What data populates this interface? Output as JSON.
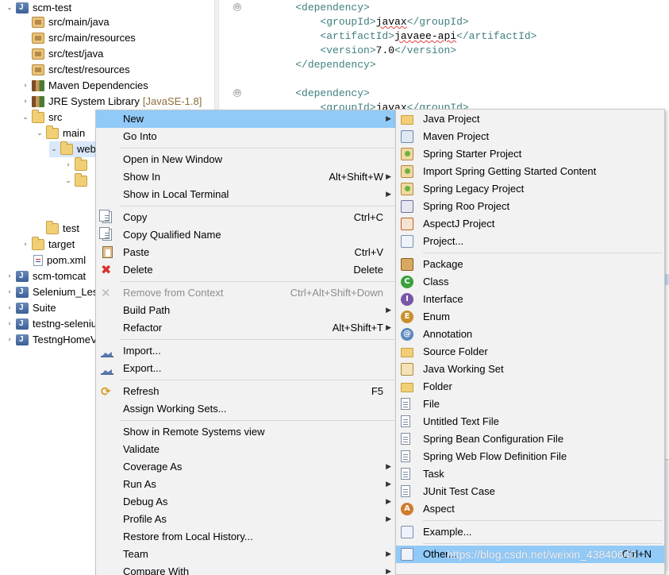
{
  "tree": {
    "items": [
      {
        "label": "scm-test",
        "twisty": "⌄"
      },
      {
        "label": "src/main/java"
      },
      {
        "label": "src/main/resources"
      },
      {
        "label": "src/test/java"
      },
      {
        "label": "src/test/resources"
      },
      {
        "label": "Maven Dependencies",
        "twisty": "›"
      },
      {
        "label": "JRE System Library",
        "decoration": "[JavaSE-1.8]",
        "twisty": "›"
      },
      {
        "label": "src",
        "twisty": "⌄"
      },
      {
        "label": "main",
        "twisty": "⌄"
      },
      {
        "label": "web",
        "twisty": "⌄"
      },
      {
        "label": "",
        "twisty": "›"
      },
      {
        "label": "",
        "twisty": "⌄"
      },
      {
        "label": "test"
      },
      {
        "label": "target",
        "twisty": "›"
      },
      {
        "label": "pom.xml"
      },
      {
        "label": "scm-tomcat",
        "twisty": "›"
      },
      {
        "label": "Selenium_Les",
        "twisty": "›"
      },
      {
        "label": "Suite",
        "twisty": "›"
      },
      {
        "label": "testng-seleniu",
        "twisty": "›"
      },
      {
        "label": "TestngHomeV",
        "twisty": "›"
      }
    ]
  },
  "editor": {
    "lines": [
      {
        "indent": "    ",
        "open": "<dependency>"
      },
      {
        "indent": "        ",
        "open": "<groupId>",
        "text": "javax",
        "close": "</groupId>"
      },
      {
        "indent": "        ",
        "open": "<artifactId>",
        "text": "javaee-api",
        "close": "</artifactId>"
      },
      {
        "indent": "        ",
        "open": "<version>",
        "text": "7.0",
        "close": "</version>"
      },
      {
        "indent": "    ",
        "open": "</dependency>"
      },
      {
        "indent": "    ",
        "open": "<dependency>"
      },
      {
        "indent": "        ",
        "open": "<groupId>",
        "text": "javax",
        "close": "</groupId>"
      }
    ],
    "fold_marker": "⊖"
  },
  "context_menu": {
    "items": [
      {
        "label": "New",
        "submenu": true,
        "highlighted": true
      },
      {
        "label": "Go Into"
      },
      {
        "label": "Open in New Window"
      },
      {
        "label": "Show In",
        "shortcut": "Alt+Shift+W",
        "submenu": true
      },
      {
        "label": "Show in Local Terminal",
        "submenu": true
      },
      {
        "label": "Copy",
        "shortcut": "Ctrl+C",
        "icon": "copy-icon"
      },
      {
        "label": "Copy Qualified Name",
        "icon": "copy-qualified-name-icon"
      },
      {
        "label": "Paste",
        "shortcut": "Ctrl+V",
        "icon": "paste-icon"
      },
      {
        "label": "Delete",
        "shortcut": "Delete",
        "icon": "delete-icon"
      },
      {
        "label": "Remove from Context",
        "shortcut": "Ctrl+Alt+Shift+Down",
        "disabled": true,
        "icon": "remove-icon"
      },
      {
        "label": "Build Path",
        "submenu": true
      },
      {
        "label": "Refactor",
        "shortcut": "Alt+Shift+T",
        "submenu": true
      },
      {
        "label": "Import...",
        "icon": "import-icon"
      },
      {
        "label": "Export...",
        "icon": "export-icon"
      },
      {
        "label": "Refresh",
        "shortcut": "F5",
        "icon": "refresh-icon"
      },
      {
        "label": "Assign Working Sets..."
      },
      {
        "label": "Show in Remote Systems view"
      },
      {
        "label": "Validate"
      },
      {
        "label": "Coverage As",
        "submenu": true
      },
      {
        "label": "Run As",
        "submenu": true
      },
      {
        "label": "Debug As",
        "submenu": true
      },
      {
        "label": "Profile As",
        "submenu": true
      },
      {
        "label": "Restore from Local History..."
      },
      {
        "label": "Team",
        "submenu": true
      },
      {
        "label": "Compare With",
        "submenu": true
      }
    ]
  },
  "new_submenu": {
    "items": [
      {
        "label": "Java Project",
        "icon": "java-project-icon"
      },
      {
        "label": "Maven Project",
        "icon": "maven-project-icon"
      },
      {
        "label": "Spring Starter Project",
        "icon": "spring-starter-icon"
      },
      {
        "label": "Import Spring Getting Started Content",
        "icon": "spring-import-icon"
      },
      {
        "label": "Spring Legacy Project",
        "icon": "spring-legacy-icon"
      },
      {
        "label": "Spring Roo Project",
        "icon": "spring-roo-icon"
      },
      {
        "label": "AspectJ Project",
        "icon": "aspectj-project-icon"
      },
      {
        "label": "Project...",
        "icon": "project-icon"
      },
      {
        "label": "Package",
        "icon": "package-icon"
      },
      {
        "label": "Class",
        "icon": "class-icon"
      },
      {
        "label": "Interface",
        "icon": "interface-icon"
      },
      {
        "label": "Enum",
        "icon": "enum-icon"
      },
      {
        "label": "Annotation",
        "icon": "annotation-icon"
      },
      {
        "label": "Source Folder",
        "icon": "source-folder-icon"
      },
      {
        "label": "Java Working Set",
        "icon": "working-set-icon"
      },
      {
        "label": "Folder",
        "icon": "folder-icon"
      },
      {
        "label": "File",
        "icon": "file-icon"
      },
      {
        "label": "Untitled Text File",
        "icon": "text-file-icon"
      },
      {
        "label": "Spring Bean Configuration File",
        "icon": "spring-bean-icon"
      },
      {
        "label": "Spring Web Flow Definition File",
        "icon": "spring-webflow-icon"
      },
      {
        "label": "Task",
        "icon": "task-icon"
      },
      {
        "label": "JUnit Test Case",
        "icon": "junit-icon"
      },
      {
        "label": "Aspect",
        "icon": "aspect-icon"
      },
      {
        "label": "Example...",
        "icon": "example-icon"
      },
      {
        "label": "Other...",
        "shortcut": "Ctrl+N",
        "highlighted": true,
        "icon": "other-icon"
      }
    ]
  },
  "watermark": "https://blog.csdn.net/weixin_43840640",
  "colors": {
    "highlight": "#91c9f7",
    "menu_bg": "#f2f2f2",
    "xml_tag": "#3f7f7f",
    "tree_selection": "#d9e8fb"
  }
}
